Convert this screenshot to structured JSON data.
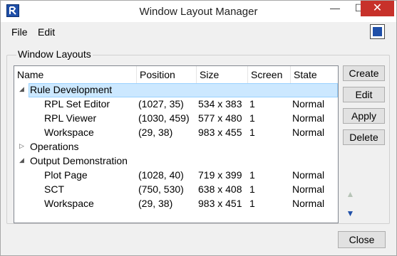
{
  "window": {
    "title": "Window Layout Manager",
    "controls": {
      "minimize": "—",
      "maximize": "☐",
      "close": "✕"
    }
  },
  "menu": {
    "file": "File",
    "edit": "Edit"
  },
  "group_label": "Window Layouts",
  "columns": [
    "Name",
    "Position",
    "Size",
    "Screen",
    "State"
  ],
  "tree": [
    {
      "name": "Rule Development",
      "level": 0,
      "expanded": true,
      "selected": true,
      "position": "",
      "size": "",
      "screen": "",
      "state": ""
    },
    {
      "name": "RPL Set Editor",
      "level": 1,
      "position": "(1027, 35)",
      "size": "534 x 383",
      "screen": "1",
      "state": "Normal"
    },
    {
      "name": "RPL Viewer",
      "level": 1,
      "position": "(1030, 459)",
      "size": "577 x 480",
      "screen": "1",
      "state": "Normal"
    },
    {
      "name": "Workspace",
      "level": 1,
      "position": "(29, 38)",
      "size": "983 x 455",
      "screen": "1",
      "state": "Normal"
    },
    {
      "name": "Operations",
      "level": 0,
      "expanded": false,
      "position": "",
      "size": "",
      "screen": "",
      "state": ""
    },
    {
      "name": "Output Demonstration",
      "level": 0,
      "expanded": true,
      "position": "",
      "size": "",
      "screen": "",
      "state": ""
    },
    {
      "name": "Plot Page",
      "level": 1,
      "position": "(1028, 40)",
      "size": "719 x 399",
      "screen": "1",
      "state": "Normal"
    },
    {
      "name": "SCT",
      "level": 1,
      "position": "(750, 530)",
      "size": "638 x 408",
      "screen": "1",
      "state": "Normal"
    },
    {
      "name": "Workspace",
      "level": 1,
      "position": "(29, 38)",
      "size": "983 x 451",
      "screen": "1",
      "state": "Normal"
    }
  ],
  "buttons": {
    "create": "Create",
    "edit": "Edit",
    "apply": "Apply",
    "delete": "Delete",
    "close": "Close"
  },
  "arrows": {
    "up": "▲",
    "down": "▼"
  },
  "icons": {
    "expanded": "◢",
    "collapsed": "▷"
  },
  "colors": {
    "selection": "#cce8ff",
    "accent": "#1f4fa8",
    "close_red": "#c7312a"
  }
}
